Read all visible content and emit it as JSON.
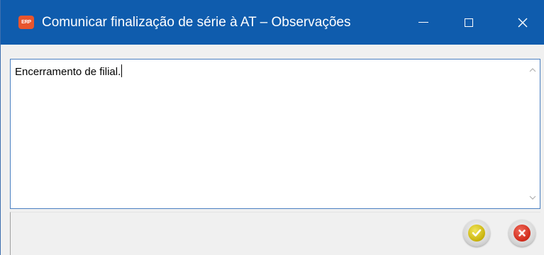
{
  "window": {
    "title": "Comunicar finalização de série à AT – Observações",
    "app_icon_text": "ERP",
    "controls": {
      "minimize_icon": "minimize-icon",
      "maximize_icon": "maximize-icon",
      "close_icon": "close-icon"
    }
  },
  "editor": {
    "text": "Encerramento de filial.",
    "scroll_up_icon": "chevron-up-icon",
    "scroll_down_icon": "chevron-down-icon"
  },
  "actions": {
    "confirm_icon": "check-icon",
    "cancel_icon": "x-icon"
  },
  "colors": {
    "titlebar": "#0f5cad",
    "confirm": "#c8b20c",
    "cancel": "#d02a1a"
  }
}
